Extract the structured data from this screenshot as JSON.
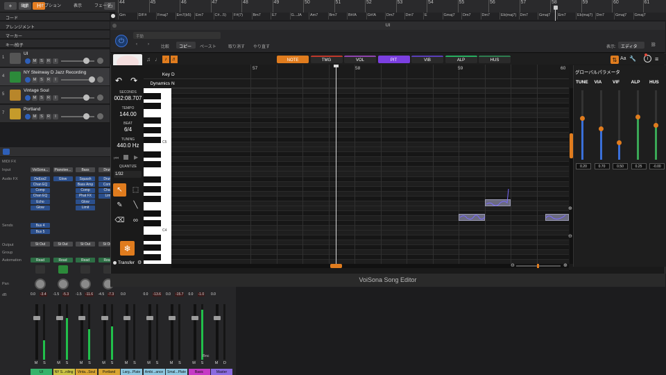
{
  "topbar": {
    "h_label": "H",
    "ruler_numbers": [
      "44",
      "45",
      "46",
      "47",
      "48",
      "49",
      "50",
      "51",
      "52",
      "53",
      "54",
      "55",
      "56",
      "57",
      "58",
      "59",
      "60",
      "61"
    ]
  },
  "chords": [
    "Gm",
    "D/F#",
    "Fmaj7",
    "Em7(b5)",
    "Em7",
    "C#...5)",
    "F#(7)",
    "Bm7",
    "E7",
    "G...JA",
    "Am7",
    "Bm7",
    "B#/A",
    "G#/A",
    "Dm7",
    "Dm7",
    "E",
    "Gmaj7",
    "Dm7",
    "Dm7",
    "Eb(maj7)",
    "Dm7",
    "Gmaj7",
    "Em7",
    "Eb(maj7)",
    "Dm7",
    "Gmaj7",
    "Gmaj7"
  ],
  "global_tracks": [
    "コード",
    "アレンジメント",
    "マーカー",
    "キー/拍子"
  ],
  "tracks": [
    {
      "num": "1",
      "name": "UI",
      "selected": false
    },
    {
      "num": "4",
      "name": "NY Steinway D Jazz Recording",
      "selected": true
    },
    {
      "num": "5",
      "name": "Vintage Soul",
      "selected": false
    },
    {
      "num": "7",
      "name": "Portland",
      "selected": false
    }
  ],
  "track_buttons": {
    "m": "M",
    "s": "S",
    "r": "R",
    "i": "I"
  },
  "mixer": {
    "menu": [
      "編集",
      "オプション",
      "表示",
      "フェーダ"
    ],
    "labels": {
      "midifx": "MIDI FX",
      "input": "Input",
      "audiofx": "Audio FX",
      "sends": "Sends",
      "output": "Output",
      "group": "Group",
      "automation": "Automation",
      "pan": "Pan",
      "db": "dB"
    },
    "strips": [
      {
        "input": "VoiSona...",
        "fx": [
          "DeEss2",
          "Chan EQ",
          "Comp",
          "Chan EQ",
          "Echo",
          "Glow"
        ],
        "sends": [
          "Bus 4",
          "Bus 5"
        ],
        "output": "St Out",
        "auto": "Read",
        "db": [
          "0.0",
          "-3.4"
        ],
        "name": "UI",
        "color": "#35b36b",
        "meter": 0.35
      },
      {
        "input": "Pianotee...",
        "fx": [
          "Glow"
        ],
        "sends": [],
        "output": "St Out",
        "auto": "Read",
        "db": [
          "-1.5",
          "-5.3"
        ],
        "name": "NY S...rding",
        "color": "#c9c245",
        "meter": 0.75
      },
      {
        "input": "Bass",
        "fx": [
          "Squash",
          "Bass Amp",
          "Comp",
          "Phat FX",
          "Glow",
          "Limit"
        ],
        "sends": [],
        "output": "St Out",
        "auto": "Read",
        "db": [
          "-1.5",
          "-11.6"
        ],
        "name": "Vinta...Soul",
        "color": "#d9a533",
        "meter": 0.55
      },
      {
        "input": "Drum",
        "fx": [
          "Drum",
          "Comp",
          "Chan",
          "Lim"
        ],
        "sends": [],
        "output": "St Out",
        "auto": "Read",
        "db": [
          "-4.5",
          "-7.3"
        ],
        "name": "Portland",
        "color": "#d9a533",
        "meter": 0.6
      },
      {
        "input": "",
        "fx": [],
        "sends": [],
        "output": "",
        "auto": "",
        "db": [
          "0.0",
          ""
        ],
        "name": "Larg...Plate",
        "color": "#8cc7e0",
        "meter": 0
      },
      {
        "input": "",
        "fx": [],
        "sends": [],
        "output": "",
        "auto": "",
        "db": [
          "0.0",
          "-13.6"
        ],
        "name": "Ambi...ance",
        "color": "#8cc7e0",
        "meter": 0
      },
      {
        "input": "",
        "fx": [],
        "sends": [],
        "output": "",
        "auto": "",
        "db": [
          "0.0",
          "-15.7"
        ],
        "name": "Smal...Plate",
        "color": "#8cc7e0",
        "meter": 0
      },
      {
        "input": "",
        "fx": [],
        "sends": [],
        "output": "",
        "auto": "",
        "db": [
          "0.0",
          "-1.0"
        ],
        "name": "Basic",
        "color": "#c63bc6",
        "meter": 0.9
      },
      {
        "input": "",
        "fx": [],
        "sends": [],
        "output": "",
        "auto": "",
        "db": [
          "0.0",
          ""
        ],
        "name": "Master",
        "color": "#8a6be0",
        "meter": 0
      }
    ],
    "bnc": "Bnc",
    "m": "M",
    "s": "S",
    "d": "D"
  },
  "plugin": {
    "window_title": "UI",
    "preset": "手動",
    "toolbar": [
      "比較",
      "コピー",
      "ペースト",
      "取り消す",
      "やり直す"
    ],
    "display_label": "表示:",
    "display_value": "エディタ",
    "tabs": [
      {
        "label": "NOTE",
        "color": "#e07c1e"
      },
      {
        "label": "TMG",
        "color": "#c0392b"
      },
      {
        "label": "VOL",
        "color": "#8e44ad"
      },
      {
        "label": "PIT",
        "color": "#7b3fe0"
      },
      {
        "label": "VIB",
        "color": "#5a3fb8"
      },
      {
        "label": "ALP",
        "color": "#27ae60"
      },
      {
        "label": "HUS",
        "color": "#2e7d4f"
      }
    ],
    "row_key": "Key",
    "row_key_val": "D",
    "row_dyn": "Dynamics",
    "row_dyn_val": "N",
    "bars": [
      "57",
      "58",
      "59",
      "60"
    ],
    "stats": [
      {
        "label": "SECONDS",
        "value": "002:08.707"
      },
      {
        "label": "TEMPO",
        "value": "144.00"
      },
      {
        "label": "BEAT",
        "value": "6/4"
      },
      {
        "label": "TUNING",
        "value": "440.0 Hz"
      }
    ],
    "quantize_label": "QUANTIZE",
    "quantize_value": "1/32",
    "c5": "C5",
    "c4": "C4",
    "transfer": "Transfer",
    "global_params": "グローバルパラメータ",
    "params": [
      {
        "name": "TUNE",
        "value": "0.20",
        "color": "#3a6fd8"
      },
      {
        "name": "VIA",
        "value": "0.70",
        "color": "#3a6fd8"
      },
      {
        "name": "VIF",
        "value": "0.50",
        "color": "#3a6fd8"
      },
      {
        "name": "ALP",
        "value": "0.25",
        "color": "#3aa856"
      },
      {
        "name": "HUS",
        "value": "-0.00",
        "color": "#3aa856"
      }
    ],
    "footer": "VoiSona Song Editor",
    "aa": "Aa"
  }
}
